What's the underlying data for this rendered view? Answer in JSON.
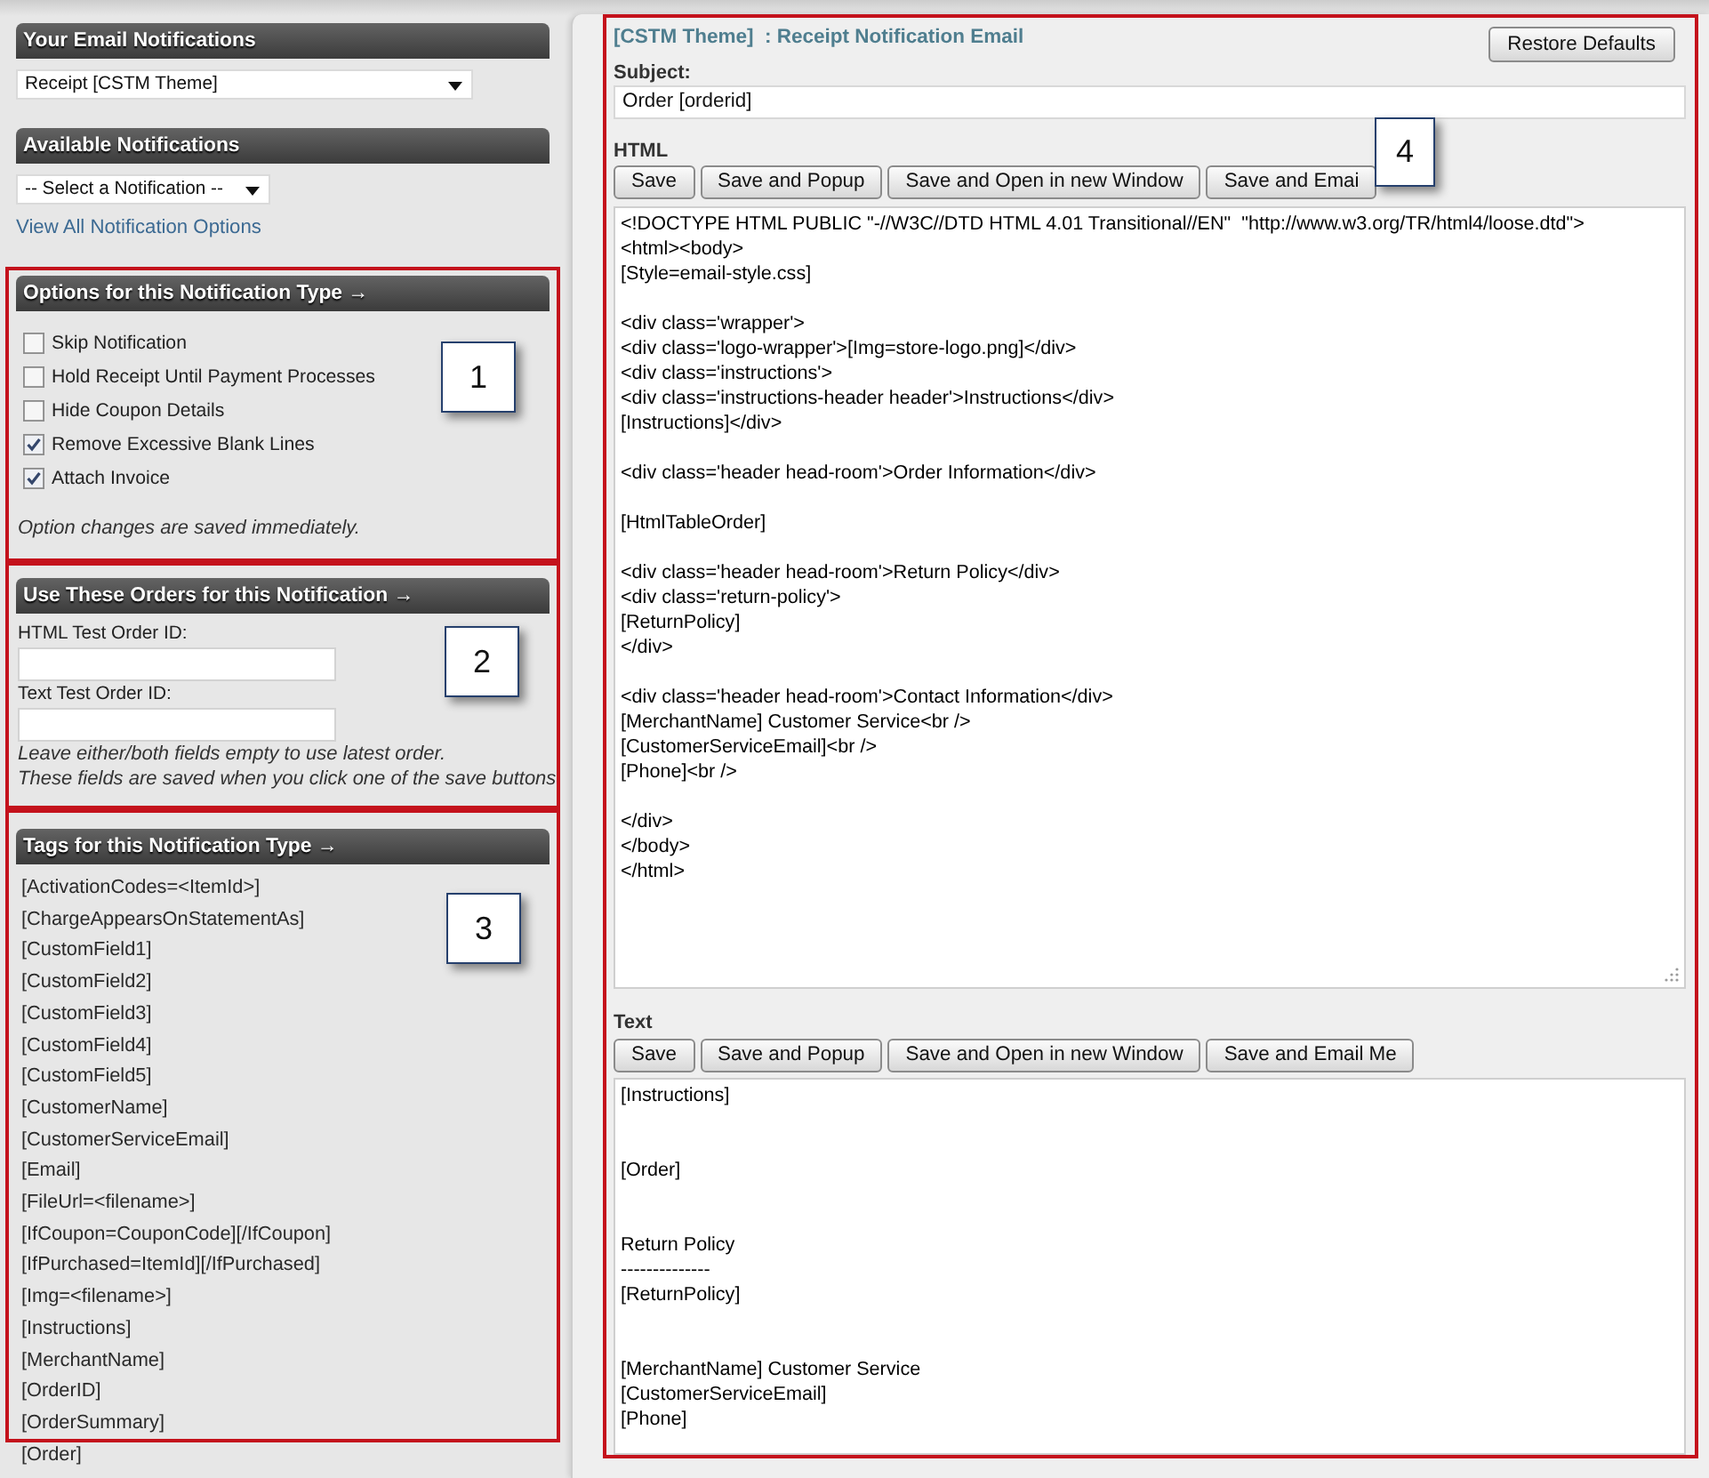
{
  "sidebar": {
    "email_notifications": {
      "title": "Your Email Notifications",
      "select": {
        "value": "Receipt [CSTM Theme]"
      }
    },
    "available_notifications": {
      "title": "Available Notifications",
      "select": {
        "value": "-- Select a Notification --"
      },
      "link": "View All Notification Options"
    },
    "options": {
      "title": "Options for this Notification Type →",
      "annotation": {
        "label": "1"
      },
      "checkboxes": [
        {
          "label": "Skip Notification",
          "checked": false
        },
        {
          "label": "Hold Receipt Until Payment Processes",
          "checked": false
        },
        {
          "label": "Hide Coupon Details",
          "checked": false
        },
        {
          "label": "Remove Excessive Blank Lines",
          "checked": true
        },
        {
          "label": "Attach Invoice",
          "checked": true
        }
      ],
      "note": "Option changes are saved immediately."
    },
    "test_orders": {
      "title": "Use These Orders for this Notification →",
      "annotation": {
        "label": "2"
      },
      "fields": [
        {
          "label": "HTML Test Order ID:"
        },
        {
          "label": "Text Test Order ID:"
        }
      ],
      "notes": [
        "Leave either/both fields empty to use latest order.",
        "These fields are saved when you click one of the save buttons"
      ]
    },
    "tags": {
      "title": "Tags for this Notification Type →",
      "annotation": {
        "label": "3"
      },
      "items": [
        "[ActivationCodes=<ItemId>]",
        "[ChargeAppearsOnStatementAs]",
        "[CustomField1]",
        "[CustomField2]",
        "[CustomField3]",
        "[CustomField4]",
        "[CustomField5]",
        "[CustomerName]",
        "[CustomerServiceEmail]",
        "[Email]",
        "[FileUrl=<filename>]",
        "[IfCoupon=CouponCode][/IfCoupon]",
        "[IfPurchased=ItemId][/IfPurchased]",
        "[Img=<filename>]",
        "[Instructions]",
        "[MerchantName]",
        "[OrderID]",
        "[OrderSummary]",
        "[Order]"
      ]
    }
  },
  "editor": {
    "title": "[CSTM Theme]  : Receipt Notification Email",
    "restore_button": "Restore Defaults",
    "annotation": {
      "label": "4"
    },
    "subject": {
      "label": "Subject:",
      "value": "Order [orderid]"
    },
    "sections": [
      {
        "label": "HTML",
        "buttons": [
          "Save",
          "Save and Popup",
          "Save and Open in new Window",
          "Save and Emai"
        ],
        "content": "<!DOCTYPE HTML PUBLIC \"-//W3C//DTD HTML 4.01 Transitional//EN\"  \"http://www.w3.org/TR/html4/loose.dtd\">\n<html><body>\n[Style=email-style.css]\n\n<div class='wrapper'>\n<div class='logo-wrapper'>[Img=store-logo.png]</div>\n<div class='instructions'>\n<div class='instructions-header header'>Instructions</div>\n[Instructions]</div>\n\n<div class='header head-room'>Order Information</div>\n\n[HtmlTableOrder]\n\n<div class='header head-room'>Return Policy</div>\n<div class='return-policy'>\n[ReturnPolicy]\n</div>\n\n<div class='header head-room'>Contact Information</div>\n[MerchantName] Customer Service<br />\n[CustomerServiceEmail]<br />\n[Phone]<br />\n\n</div>\n</body>\n</html>"
      },
      {
        "label": "Text",
        "buttons": [
          "Save",
          "Save and Popup",
          "Save and Open in new Window",
          "Save and Email Me"
        ],
        "content": "[Instructions]\n\n\n[Order]\n\n\nReturn Policy\n--------------\n[ReturnPolicy]\n\n\n[MerchantName] Customer Service\n[CustomerServiceEmail]\n[Phone]"
      }
    ]
  }
}
